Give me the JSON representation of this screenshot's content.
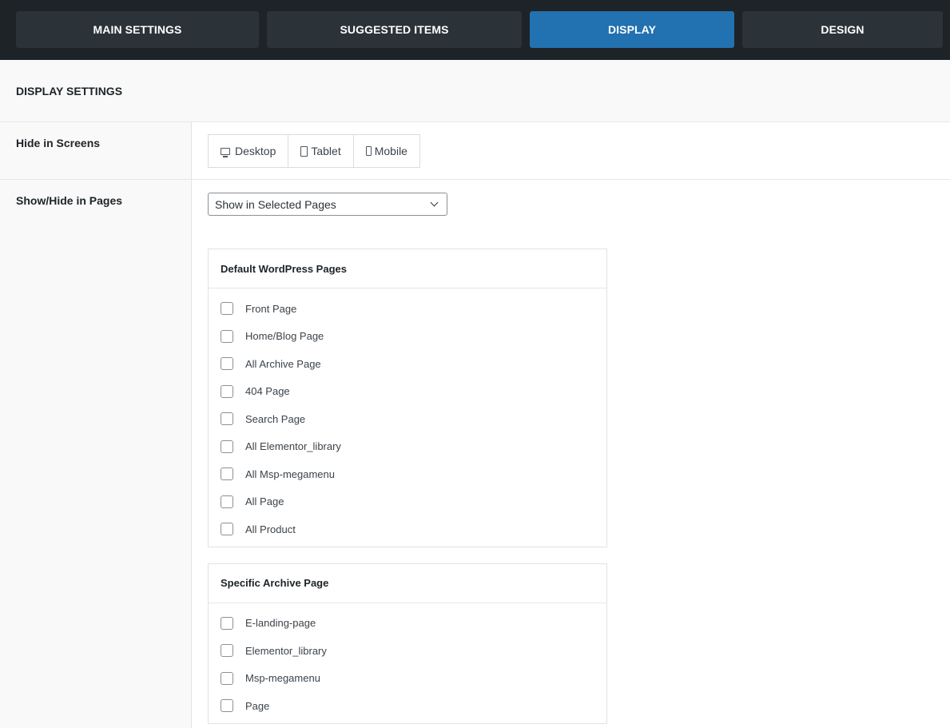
{
  "tabs": [
    {
      "label": "MAIN SETTINGS",
      "active": false
    },
    {
      "label": "SUGGESTED ITEMS",
      "active": false
    },
    {
      "label": "DISPLAY",
      "active": true
    },
    {
      "label": "DESIGN",
      "active": false
    }
  ],
  "section_title": "DISPLAY SETTINGS",
  "hide_in_screens": {
    "label": "Hide in Screens",
    "options": [
      "Desktop",
      "Tablet",
      "Mobile"
    ]
  },
  "show_hide_pages": {
    "label": "Show/Hide in Pages",
    "selected": "Show in Selected Pages"
  },
  "default_pages": {
    "title": "Default WordPress Pages",
    "items": [
      "Front Page",
      "Home/Blog Page",
      "All Archive Page",
      "404 Page",
      "Search Page",
      "All Elementor_library",
      "All Msp-megamenu",
      "All Page",
      "All Product"
    ]
  },
  "archive_pages": {
    "title": "Specific Archive Page",
    "items": [
      "E-landing-page",
      "Elementor_library",
      "Msp-megamenu",
      "Page"
    ]
  },
  "colors": {
    "topbar": "#1d2327",
    "tab": "#2c3338",
    "tab_active": "#2271b1"
  }
}
